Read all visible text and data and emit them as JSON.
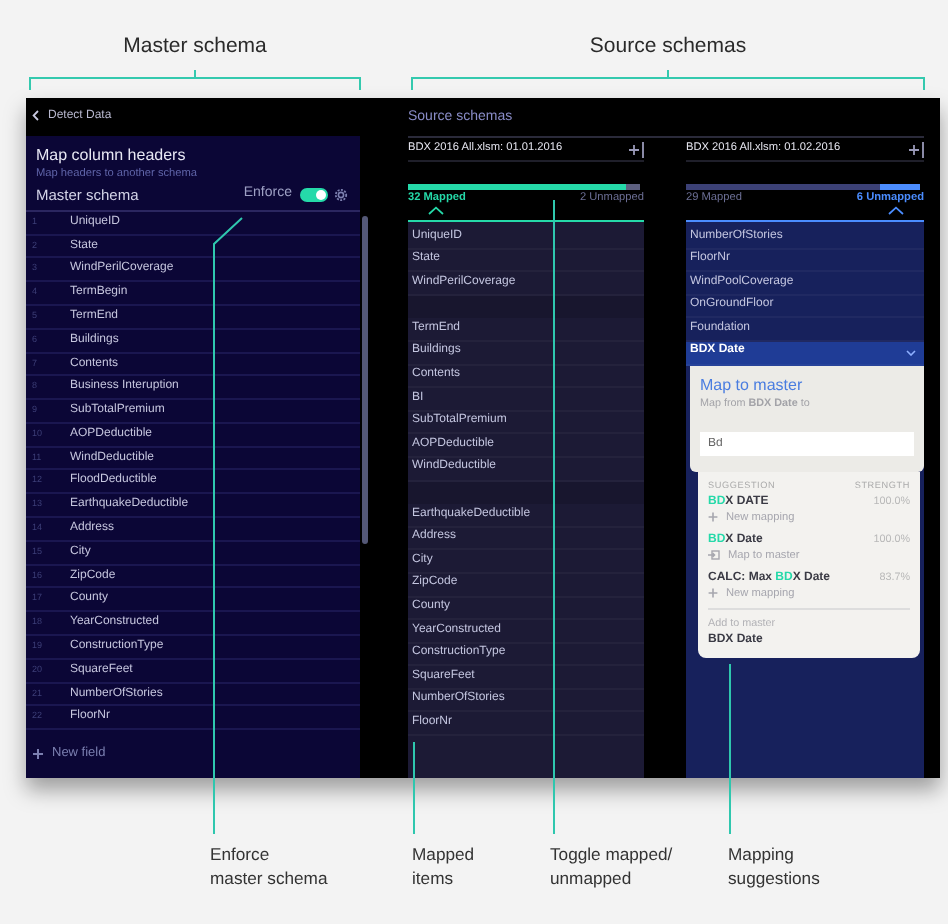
{
  "top_annotations": [
    {
      "label": "Master schema"
    },
    {
      "label": "Source schemas"
    }
  ],
  "master": {
    "back_link": "Detect Data",
    "title": "Map column headers",
    "subtitle": "Map headers to another schema",
    "schema_label": "Master schema",
    "enforce_label": "Enforce",
    "enforce_on": true,
    "fields": [
      {
        "number": "1",
        "name": "UniqueID"
      },
      {
        "number": "2",
        "name": "State"
      },
      {
        "number": "3",
        "name": "WindPerilCoverage"
      },
      {
        "number": "4",
        "name": "TermBegin"
      },
      {
        "number": "5",
        "name": "TermEnd"
      },
      {
        "number": "6",
        "name": "Buildings"
      },
      {
        "number": "7",
        "name": "Contents"
      },
      {
        "number": "8",
        "name": "Business Interuption"
      },
      {
        "number": "9",
        "name": "SubTotalPremium"
      },
      {
        "number": "10",
        "name": "AOPDeductible"
      },
      {
        "number": "11",
        "name": "WindDeductible"
      },
      {
        "number": "12",
        "name": "FloodDeductible"
      },
      {
        "number": "13",
        "name": "EarthquakeDeductible"
      },
      {
        "number": "14",
        "name": "Address"
      },
      {
        "number": "15",
        "name": "City"
      },
      {
        "number": "16",
        "name": "ZipCode"
      },
      {
        "number": "17",
        "name": "County"
      },
      {
        "number": "18",
        "name": "YearConstructed"
      },
      {
        "number": "19",
        "name": "ConstructionType"
      },
      {
        "number": "20",
        "name": "SquareFeet"
      },
      {
        "number": "21",
        "name": "NumberOfStories"
      },
      {
        "number": "22",
        "name": "FloorNr"
      }
    ],
    "new_field": "New field"
  },
  "source_title": "Source schemas",
  "sources": [
    {
      "file": "BDX 2016 All.xlsm: 01.01.2016",
      "level": 0.94,
      "filters": [
        {
          "label": "32 Mapped",
          "selected": true
        },
        {
          "label": "2 Unmapped",
          "selected": false
        }
      ],
      "items": [
        {
          "name": "UniqueID",
          "selected": false
        },
        {
          "name": "State",
          "selected": false
        },
        {
          "name": "WindPerilCoverage",
          "selected": false
        },
        {
          "kind": "blank"
        },
        {
          "name": "TermEnd",
          "selected": false
        },
        {
          "name": "Buildings",
          "selected": false
        },
        {
          "name": "Contents",
          "selected": false
        },
        {
          "name": "BI",
          "selected": false
        },
        {
          "name": "SubTotalPremium",
          "selected": false
        },
        {
          "name": "AOPDeductible",
          "selected": false
        },
        {
          "name": "WindDeductible",
          "selected": false
        },
        {
          "kind": "blank"
        },
        {
          "name": "EarthquakeDeductible",
          "selected": false
        },
        {
          "name": "Address",
          "selected": false
        },
        {
          "name": "City",
          "selected": false
        },
        {
          "name": "ZipCode",
          "selected": false
        },
        {
          "name": "County",
          "selected": false
        },
        {
          "name": "YearConstructed",
          "selected": false
        },
        {
          "name": "ConstructionType",
          "selected": false
        },
        {
          "name": "SquareFeet",
          "selected": false
        },
        {
          "name": "NumberOfStories",
          "selected": false
        },
        {
          "name": "FloorNr",
          "selected": false
        }
      ]
    },
    {
      "file": "BDX 2016 All.xlsm: 01.02.2016",
      "level": 0.83,
      "filters": [
        {
          "label": "29 Mapped",
          "selected": false
        },
        {
          "label": "6 Unmapped",
          "selected": true
        }
      ],
      "items": [
        {
          "name": "NumberOfStories",
          "selected": false
        },
        {
          "name": "FloorNr",
          "selected": false
        },
        {
          "name": "WindPoolCoverage",
          "selected": false
        },
        {
          "name": "OnGroundFloor",
          "selected": false
        },
        {
          "name": "Foundation",
          "selected": false
        },
        {
          "name": "BDX Date",
          "selected": true
        }
      ],
      "popup": {
        "title": "Map to master",
        "from_text": "Map from **BDX Date** to",
        "input_value": "Bd",
        "col_suggestion": "SUGGESTION",
        "col_strength": "STRENGTH",
        "suggestions": [
          {
            "parts": [
              {
                "text": "BD",
                "match": true
              },
              {
                "text": "X DATE",
                "match": false
              }
            ],
            "strength": "100.0%",
            "kind": "new",
            "action": "New mapping"
          },
          {
            "parts": [
              {
                "text": "BD",
                "match": true
              },
              {
                "text": "X Date",
                "match": false
              }
            ],
            "strength": "100.0%",
            "kind": "map",
            "action": "Map to master"
          },
          {
            "parts": [
              {
                "text": "CALC: Max ",
                "match": false
              },
              {
                "text": "BD",
                "match": true
              },
              {
                "text": "X Date",
                "match": false
              }
            ],
            "strength": "83.7%",
            "kind": "new",
            "action": "New mapping"
          }
        ],
        "add_label": "Add to master",
        "add_value": "BDX Date"
      }
    }
  ],
  "callouts": [
    {
      "lines": [
        "Enforce",
        "master schema"
      ]
    },
    {
      "lines": [
        "Mapped",
        "items"
      ]
    },
    {
      "lines": [
        "Toggle mapped/",
        "unmapped"
      ]
    },
    {
      "lines": [
        "Mapping",
        "suggestions"
      ]
    }
  ]
}
